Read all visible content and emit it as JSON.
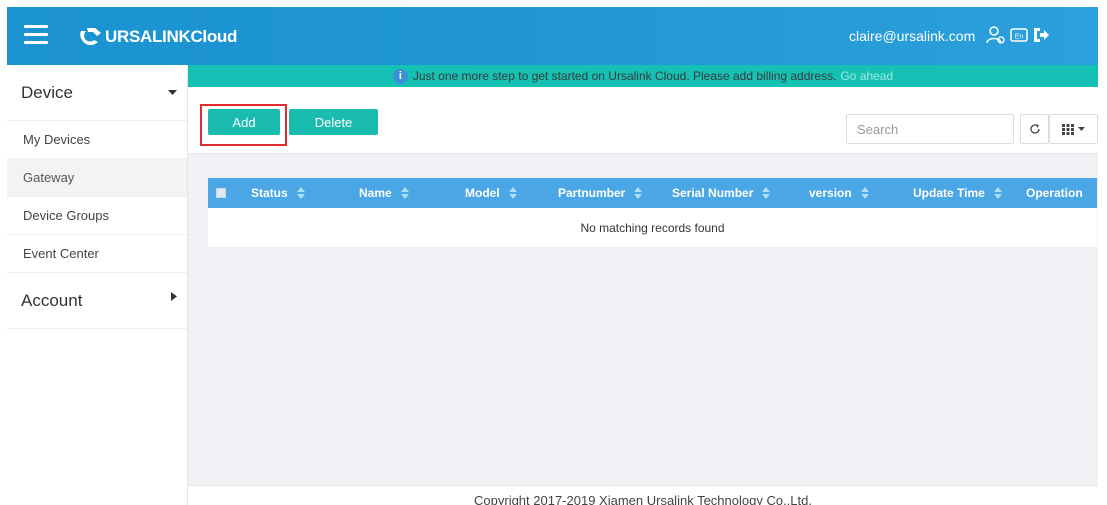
{
  "header": {
    "logo_text": "URSALINK",
    "logo_suffix": "Cloud",
    "user_email": "claire@ursalink.com",
    "icons": [
      "hamburger-icon",
      "user-settings-icon",
      "language-icon",
      "logout-icon"
    ]
  },
  "sidebar": {
    "device_label": "Device",
    "items": [
      {
        "label": "My Devices"
      },
      {
        "label": "Gateway"
      },
      {
        "label": "Device Groups"
      },
      {
        "label": "Event Center"
      }
    ],
    "account_label": "Account",
    "active_item": "Gateway"
  },
  "notice": {
    "text": "Just one more step to get started on Ursalink Cloud. Please add billing address.",
    "link": "Go ahead"
  },
  "toolbar": {
    "add_label": "Add",
    "delete_label": "Delete",
    "search_placeholder": "Search"
  },
  "table": {
    "columns": [
      "Status",
      "Name",
      "Model",
      "Partnumber",
      "Serial Number",
      "version",
      "Update Time",
      "Operation"
    ],
    "empty_message": "No matching records found"
  },
  "footer": {
    "copyright": "Copyright 2017-2019 Xiamen Ursalink Technology Co.,Ltd."
  },
  "colors": {
    "header_blue": "#1f95d3",
    "notice_teal": "#14c1b4",
    "button_teal": "#1abcb0",
    "table_header": "#4ba6e6",
    "highlight_red": "#e02c2c"
  }
}
